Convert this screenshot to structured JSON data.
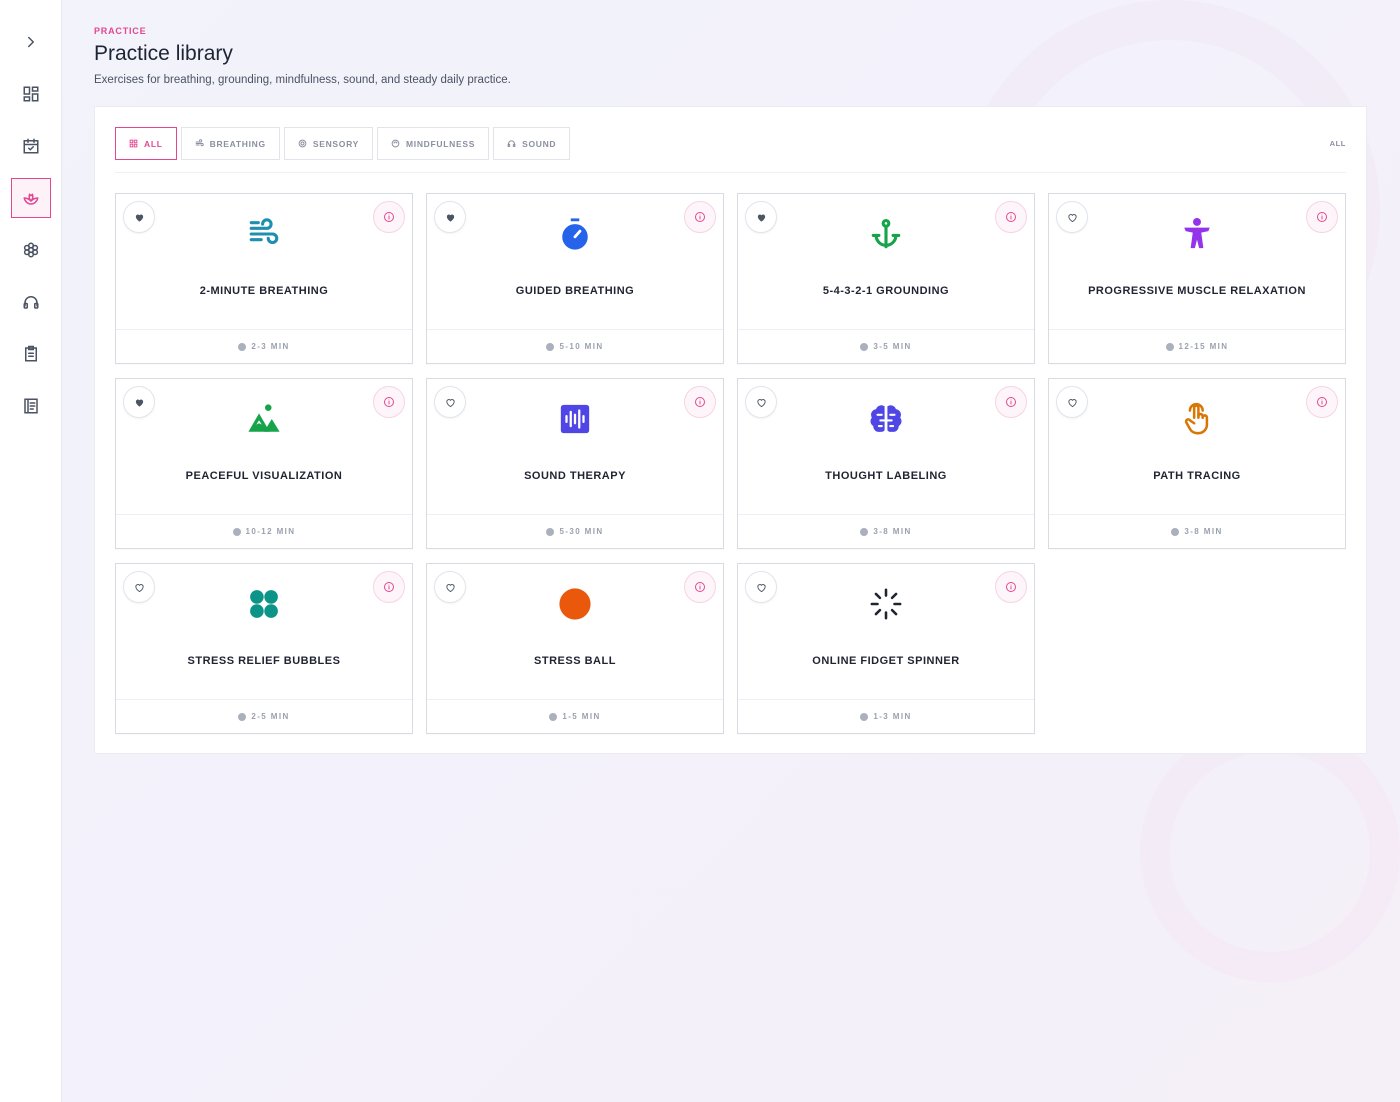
{
  "header": {
    "eyebrow": "PRACTICE",
    "title": "Practice library",
    "subtitle": "Exercises for breathing, grounding, mindfulness, sound, and steady daily practice."
  },
  "sidebar": {
    "items": [
      {
        "name": "expand",
        "icon": "chevron-right-icon"
      },
      {
        "name": "dashboard",
        "icon": "dashboard-icon"
      },
      {
        "name": "calendar",
        "icon": "calendar-check-icon"
      },
      {
        "name": "practice",
        "icon": "lotus-icon",
        "active": true
      },
      {
        "name": "flower",
        "icon": "flower-icon"
      },
      {
        "name": "audio",
        "icon": "headphones-icon"
      },
      {
        "name": "clipboard",
        "icon": "clipboard-icon"
      },
      {
        "name": "journal",
        "icon": "journal-icon"
      }
    ]
  },
  "filters": {
    "chips": [
      {
        "label": "ALL",
        "icon": "grid-icon",
        "active": true
      },
      {
        "label": "BREATHING",
        "icon": "wind-icon"
      },
      {
        "label": "SENSORY",
        "icon": "sensory-icon"
      },
      {
        "label": "MINDFULNESS",
        "icon": "mindfulness-icon"
      },
      {
        "label": "SOUND",
        "icon": "headphones-icon"
      }
    ],
    "right_label": "ALL"
  },
  "cards": [
    {
      "title": "2-MINUTE BREATHING",
      "duration": "2-3 MIN",
      "favorited": true,
      "icon": "wind-icon",
      "color": "#1f8fb0"
    },
    {
      "title": "GUIDED BREATHING",
      "duration": "5-10 MIN",
      "favorited": true,
      "icon": "stopwatch-icon",
      "color": "#2563eb"
    },
    {
      "title": "5-4-3-2-1 GROUNDING",
      "duration": "3-5 MIN",
      "favorited": true,
      "icon": "anchor-icon",
      "color": "#16a34a"
    },
    {
      "title": "PROGRESSIVE MUSCLE RELAXATION",
      "duration": "12-15 MIN",
      "favorited": false,
      "icon": "person-icon",
      "color": "#9333ea"
    },
    {
      "title": "PEACEFUL VISUALIZATION",
      "duration": "10-12 MIN",
      "favorited": true,
      "icon": "mountain-icon",
      "color": "#16a34a"
    },
    {
      "title": "SOUND THERAPY",
      "duration": "5-30 MIN",
      "favorited": false,
      "icon": "audio-wave-icon",
      "color": "#4f46e5"
    },
    {
      "title": "THOUGHT LABELING",
      "duration": "3-8 MIN",
      "favorited": false,
      "icon": "brain-icon",
      "color": "#4f46e5"
    },
    {
      "title": "PATH TRACING",
      "duration": "3-8 MIN",
      "favorited": false,
      "icon": "hand-pointer-icon",
      "color": "#d97706"
    },
    {
      "title": "STRESS RELIEF BUBBLES",
      "duration": "2-5 MIN",
      "favorited": false,
      "icon": "bubbles-icon",
      "color": "#0d9488"
    },
    {
      "title": "STRESS BALL",
      "duration": "1-5 MIN",
      "favorited": false,
      "icon": "ball-icon",
      "color": "#ea580c"
    },
    {
      "title": "ONLINE FIDGET SPINNER",
      "duration": "1-3 MIN",
      "favorited": false,
      "icon": "spinner-icon",
      "color": "#1f2433"
    }
  ],
  "colors": {
    "accent": "#e2488f",
    "heart_filled": "#4b5563",
    "muted": "#9aa0ae"
  }
}
